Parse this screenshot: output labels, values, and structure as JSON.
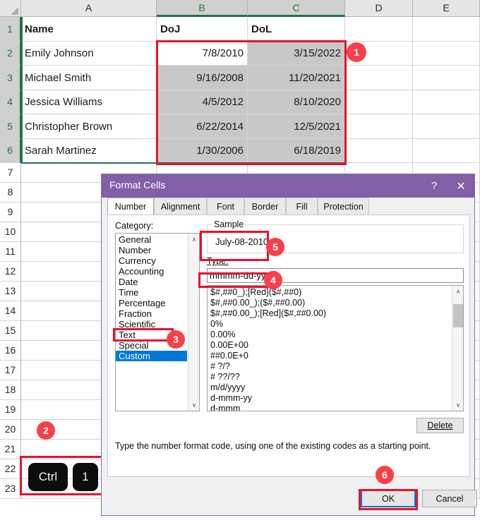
{
  "spreadsheet": {
    "columns": [
      "A",
      "B",
      "C",
      "D",
      "E"
    ],
    "rows": [
      "1",
      "2",
      "3",
      "4",
      "5",
      "6",
      "7",
      "8",
      "9",
      "10",
      "11",
      "12",
      "13",
      "14",
      "15",
      "16",
      "17",
      "18",
      "19",
      "20",
      "21",
      "22",
      "23"
    ],
    "headers": {
      "a": "Name",
      "b": "DoJ",
      "c": "DoL"
    },
    "data": [
      {
        "name": "Emily Johnson",
        "doj": "7/8/2010",
        "dol": "3/15/2022"
      },
      {
        "name": "Michael Smith",
        "doj": "9/16/2008",
        "dol": "11/20/2021"
      },
      {
        "name": "Jessica Williams",
        "doj": "4/5/2012",
        "dol": "8/10/2020"
      },
      {
        "name": "Christopher Brown",
        "doj": "6/22/2014",
        "dol": "12/5/2021"
      },
      {
        "name": "Sarah Martinez",
        "doj": "1/30/2006",
        "dol": "6/18/2019"
      }
    ],
    "selected_columns": [
      "B",
      "C"
    ],
    "active_cell_value": "7/8/2010"
  },
  "shortcut": {
    "keys": [
      "Ctrl",
      "1"
    ]
  },
  "annotations": {
    "badge1": "1",
    "badge2": "2",
    "badge3": "3",
    "badge4": "4",
    "badge5": "5",
    "badge6": "6",
    "color": "#f8404a",
    "outline_color": "#e8112d"
  },
  "dialog": {
    "title": "Format Cells",
    "help_icon": "?",
    "close_icon": "✕",
    "tabs": [
      {
        "label": "Number",
        "active": true
      },
      {
        "label": "Alignment",
        "active": false
      },
      {
        "label": "Font",
        "active": false
      },
      {
        "label": "Border",
        "active": false
      },
      {
        "label": "Fill",
        "active": false
      },
      {
        "label": "Protection",
        "active": false
      }
    ],
    "category_label": "Category:",
    "categories": [
      "General",
      "Number",
      "Currency",
      "Accounting",
      "Date",
      "Time",
      "Percentage",
      "Fraction",
      "Scientific",
      "Text",
      "Special",
      "Custom"
    ],
    "selected_category": "Custom",
    "sample_legend": "Sample",
    "sample_value": "July-08-2010",
    "type_label": "Type:",
    "type_value": "mmmm-dd-yyyy",
    "format_codes": [
      "$#,##0_);[Red]($#,##0)",
      "$#,##0.00_);($#,##0.00)",
      "$#,##0.00_);[Red]($#,##0.00)",
      "0%",
      "0.00%",
      "0.00E+00",
      "##0.0E+0",
      "# ?/?",
      "# ??/??",
      "m/d/yyyy",
      "d-mmm-yy",
      "d-mmm"
    ],
    "delete_label": "Delete",
    "help_text": "Type the number format code, using one of the existing codes as a starting point.",
    "ok_label": "OK",
    "cancel_label": "Cancel",
    "scroll_up_icon": "∧",
    "scroll_down_icon": "∨"
  }
}
